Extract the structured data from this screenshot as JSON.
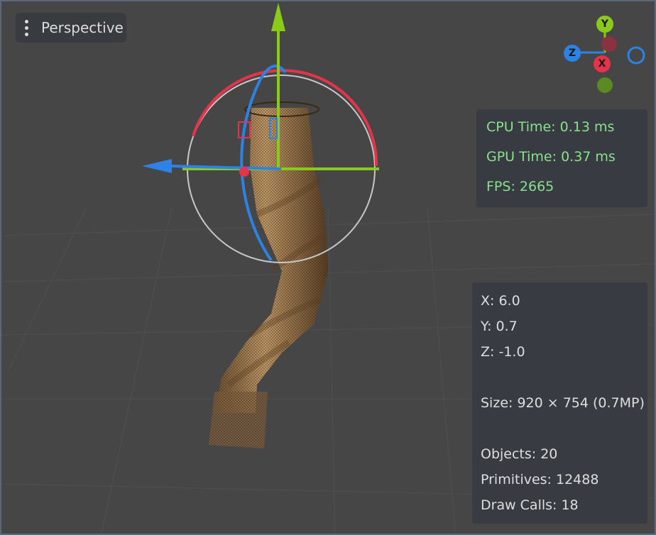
{
  "view_menu": {
    "label": "Perspective",
    "icon": "kebab-menu-icon"
  },
  "axis_gizmo": {
    "x": "X",
    "y": "Y",
    "z": "Z",
    "colors": {
      "x": "#e5334a",
      "y": "#8acb1a",
      "z": "#2c82e5"
    }
  },
  "perf": {
    "cpu": "CPU Time: 0.13 ms",
    "gpu": "GPU Time: 0.37 ms",
    "fps": "FPS: 2665"
  },
  "info": {
    "x": "X: 6.0",
    "y": "Y: 0.7",
    "z": "Z: -1.0",
    "size": "Size: 920 × 754 (0.7MP)",
    "objects": "Objects: 20",
    "primitives": "Primitives: 12488",
    "draw_calls": "Draw Calls: 18"
  },
  "colors": {
    "perf_text": "#88e28a",
    "mesh": "#a07a4e",
    "viewport_border": "#5a6a7a"
  }
}
